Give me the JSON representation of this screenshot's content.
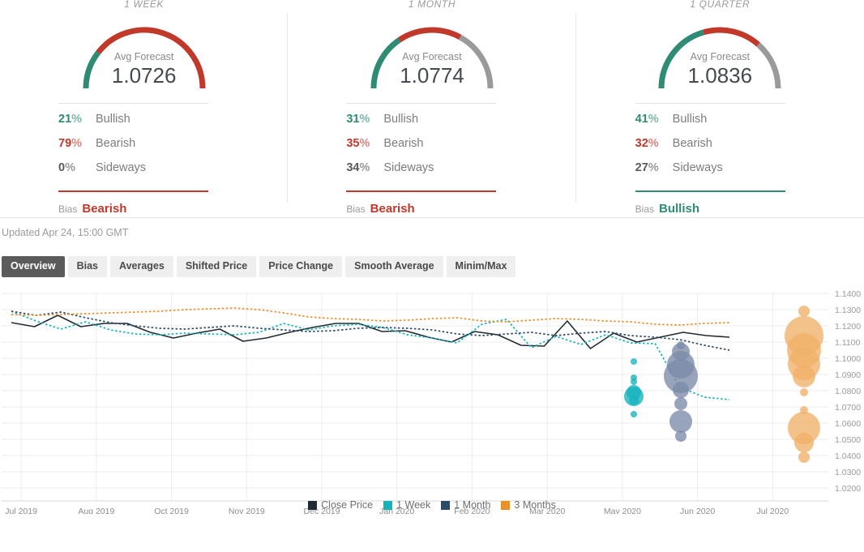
{
  "panels": [
    {
      "title": "1 WEEK",
      "gauge_label": "Avg Forecast",
      "gauge_value": "1.0726",
      "stats": [
        {
          "pct": "21",
          "sign": "%",
          "name": "Bullish",
          "color": "#2e8b74"
        },
        {
          "pct": "79",
          "sign": "%",
          "name": "Bearish",
          "color": "#c0392b"
        },
        {
          "pct": "0",
          "sign": "%",
          "name": "Sideways",
          "color": "#5a5a5a"
        }
      ],
      "bias_label": "Bias",
      "bias_value": "Bearish",
      "bias_color": "#c0392b",
      "arc": {
        "bullish": 21,
        "bearish": 79,
        "sideways": 0
      }
    },
    {
      "title": "1 MONTH",
      "gauge_label": "Avg Forecast",
      "gauge_value": "1.0774",
      "stats": [
        {
          "pct": "31",
          "sign": "%",
          "name": "Bullish",
          "color": "#2e8b74"
        },
        {
          "pct": "35",
          "sign": "%",
          "name": "Bearish",
          "color": "#c0392b"
        },
        {
          "pct": "34",
          "sign": "%",
          "name": "Sideways",
          "color": "#5a5a5a"
        }
      ],
      "bias_label": "Bias",
      "bias_value": "Bearish",
      "bias_color": "#c0392b",
      "arc": {
        "bullish": 31,
        "bearish": 35,
        "sideways": 34
      }
    },
    {
      "title": "1 QUARTER",
      "gauge_label": "Avg Forecast",
      "gauge_value": "1.0836",
      "stats": [
        {
          "pct": "41",
          "sign": "%",
          "name": "Bullish",
          "color": "#2e8b74"
        },
        {
          "pct": "32",
          "sign": "%",
          "name": "Bearish",
          "color": "#c0392b"
        },
        {
          "pct": "27",
          "sign": "%",
          "name": "Sideways",
          "color": "#5a5a5a"
        }
      ],
      "bias_label": "Bias",
      "bias_value": "Bullish",
      "bias_color": "#2e8b74",
      "arc": {
        "bullish": 41,
        "bearish": 32,
        "sideways": 27
      }
    }
  ],
  "updated": "Updated Apr 24, 15:00 GMT",
  "tabs": [
    {
      "label": "Overview",
      "active": true
    },
    {
      "label": "Bias",
      "active": false
    },
    {
      "label": "Averages",
      "active": false
    },
    {
      "label": "Shifted Price",
      "active": false
    },
    {
      "label": "Price Change",
      "active": false
    },
    {
      "label": "Smooth Average",
      "active": false
    },
    {
      "label": "Minim/Max",
      "active": false
    }
  ],
  "colors": {
    "bullish": "#2e8b74",
    "bearish": "#c0392b",
    "sideways": "#9a9a9a",
    "close_price": "#222b33",
    "one_week": "#17b3bd",
    "one_month": "#2d4a68",
    "three_months": "#e8912a"
  },
  "chart_data": {
    "type": "line",
    "title": "",
    "xlabel": "",
    "ylabel": "",
    "ylim": [
      1.02,
      1.14
    ],
    "ytick_labels": [
      "1.1400",
      "1.1300",
      "1.1200",
      "1.1100",
      "1.1000",
      "1.0900",
      "1.0800",
      "1.0700",
      "1.0600",
      "1.0500",
      "1.0400",
      "1.0300",
      "1.0200"
    ],
    "ytick_values": [
      1.14,
      1.13,
      1.12,
      1.11,
      1.1,
      1.09,
      1.08,
      1.07,
      1.06,
      1.05,
      1.04,
      1.03,
      1.02
    ],
    "xtick_labels": [
      "Jul 2019",
      "Aug 2019",
      "Oct 2019",
      "Nov 2019",
      "Dec 2019",
      "Jan 2020",
      "Feb 2020",
      "Mar 2020",
      "May 2020",
      "Jun 2020",
      "Jul 2020"
    ],
    "grid": true,
    "legend_position": "bottom",
    "legend": [
      {
        "name": "Close Price",
        "color": "#222b33",
        "style": "solid"
      },
      {
        "name": "1 Week",
        "color": "#17b3bd",
        "style": "dotted"
      },
      {
        "name": "1 Month",
        "color": "#2d4a68",
        "style": "dotted"
      },
      {
        "name": "3 Months",
        "color": "#e8912a",
        "style": "dotted"
      }
    ],
    "series": [
      {
        "name": "Close Price",
        "color": "#222b33",
        "style": "solid",
        "values": [
          1.122,
          1.1195,
          1.1265,
          1.1195,
          1.1215,
          1.1215,
          1.116,
          1.1125,
          1.1155,
          1.118,
          1.1105,
          1.1125,
          1.116,
          1.119,
          1.1215,
          1.1215,
          1.1165,
          1.117,
          1.113,
          1.11,
          1.1165,
          1.1145,
          1.108,
          1.1075,
          1.123,
          1.106,
          1.1155,
          1.11,
          1.113,
          1.116,
          1.114,
          1.113
        ]
      },
      {
        "name": "1 Week",
        "color": "#17b3bd",
        "style": "dotted",
        "values": [
          1.129,
          1.123,
          1.118,
          1.1225,
          1.1175,
          1.115,
          1.1145,
          1.1155,
          1.115,
          1.1145,
          1.116,
          1.1215,
          1.1175,
          1.12,
          1.121,
          1.119,
          1.1145,
          1.1125,
          1.1095,
          1.121,
          1.124,
          1.1065,
          1.1135,
          1.1085,
          1.1145,
          1.1095,
          1.109,
          1.082,
          1.076,
          1.0745
        ]
      },
      {
        "name": "1 Month",
        "color": "#2d4a68",
        "style": "dotted",
        "values": [
          1.129,
          1.1265,
          1.1285,
          1.125,
          1.122,
          1.12,
          1.1185,
          1.118,
          1.119,
          1.12,
          1.1185,
          1.1175,
          1.1165,
          1.117,
          1.1185,
          1.119,
          1.1185,
          1.1175,
          1.115,
          1.114,
          1.115,
          1.116,
          1.114,
          1.1155,
          1.1165,
          1.114,
          1.113,
          1.1115,
          1.108,
          1.105
        ]
      },
      {
        "name": "3 Months",
        "color": "#e8912a",
        "style": "dotted",
        "values": [
          1.127,
          1.1265,
          1.127,
          1.1275,
          1.128,
          1.1285,
          1.129,
          1.13,
          1.1305,
          1.131,
          1.13,
          1.128,
          1.1255,
          1.1245,
          1.124,
          1.123,
          1.1235,
          1.1245,
          1.125,
          1.123,
          1.1225,
          1.1235,
          1.1245,
          1.124,
          1.123,
          1.1225,
          1.121,
          1.1205,
          1.1215,
          1.122
        ]
      }
    ],
    "bubble_clusters": [
      {
        "name": "1 Week",
        "color": "#17b3bd",
        "x_label": "May 2020",
        "bubbles": [
          {
            "value": 1.098,
            "size": 4
          },
          {
            "value": 1.088,
            "size": 4
          },
          {
            "value": 1.0855,
            "size": 4
          },
          {
            "value": 1.079,
            "size": 9
          },
          {
            "value": 1.0765,
            "size": 12
          },
          {
            "value": 1.074,
            "size": 6
          },
          {
            "value": 1.0655,
            "size": 4
          }
        ]
      },
      {
        "name": "1 Month",
        "color": "#7b8ba8",
        "x_label": "May 2020",
        "bubbles": [
          {
            "value": 1.108,
            "size": 5
          },
          {
            "value": 1.104,
            "size": 11
          },
          {
            "value": 1.096,
            "size": 17
          },
          {
            "value": 1.089,
            "size": 21
          },
          {
            "value": 1.0805,
            "size": 10
          },
          {
            "value": 1.072,
            "size": 8
          },
          {
            "value": 1.061,
            "size": 14
          },
          {
            "value": 1.052,
            "size": 7
          }
        ]
      },
      {
        "name": "3 Months",
        "color": "#efb169",
        "x_label": "Jul 2020",
        "bubbles": [
          {
            "value": 1.129,
            "size": 7
          },
          {
            "value": 1.114,
            "size": 24
          },
          {
            "value": 1.105,
            "size": 21
          },
          {
            "value": 1.0965,
            "size": 20
          },
          {
            "value": 1.089,
            "size": 14
          },
          {
            "value": 1.079,
            "size": 5
          },
          {
            "value": 1.068,
            "size": 5
          },
          {
            "value": 1.057,
            "size": 20
          },
          {
            "value": 1.048,
            "size": 12
          },
          {
            "value": 1.039,
            "size": 7
          }
        ]
      }
    ]
  }
}
